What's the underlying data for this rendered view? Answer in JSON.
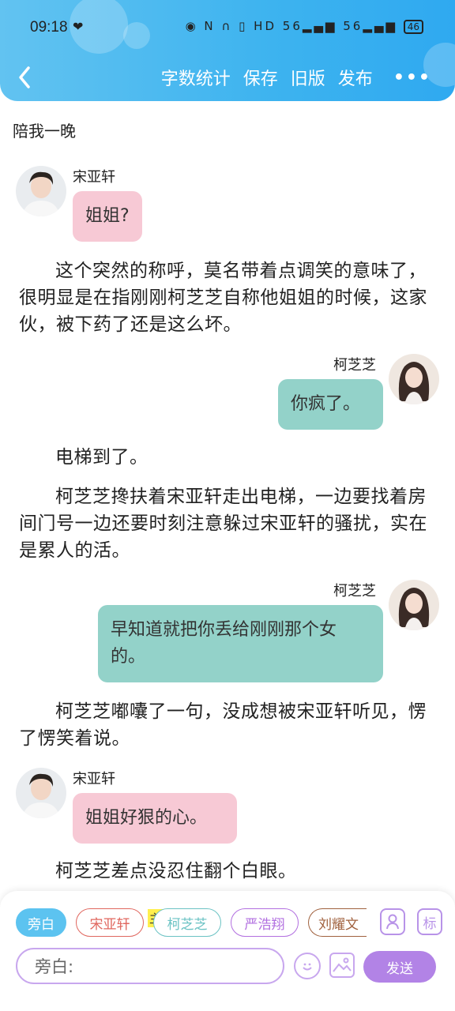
{
  "status_bar": {
    "time": "09:18",
    "icons_text": "◉ N ∩ ▯ HD 56▂▄▆ 56▂▄▆",
    "battery": "46"
  },
  "header": {
    "back_icon": "chevron-left-icon",
    "actions": [
      "字数统计",
      "保存",
      "旧版",
      "发布"
    ],
    "more_icon": "•••"
  },
  "chapter": {
    "title": "陪我一晚"
  },
  "messages": [
    {
      "speaker": "宋亚轩",
      "text": "姐姐?",
      "side": "left",
      "color": "#f7c9d5"
    },
    {
      "narration": "这个突然的称呼，莫名带着点调笑的意味了，很明显是在指刚刚柯芝芝自称他姐姐的时候，这家伙，被下药了还是这么坏。"
    },
    {
      "speaker": "柯芝芝",
      "text": "你疯了。",
      "side": "right",
      "color": "#93d2c9"
    },
    {
      "narration": "电梯到了。"
    },
    {
      "narration": "柯芝芝搀扶着宋亚轩走出电梯，一边要找着房间门号一边还要时刻注意躲过宋亚轩的骚扰，实在是累人的活。"
    },
    {
      "speaker": "柯芝芝",
      "text": "早知道就把你丢给刚刚那个女的。",
      "side": "right",
      "color": "#93d2c9"
    },
    {
      "narration": "柯芝芝嘟囔了一句，没成想被宋亚轩听见，愣了愣笑着说。"
    },
    {
      "speaker": "宋亚轩",
      "text": "姐姐好狠的心。",
      "side": "left",
      "color": "#f7c9d5"
    },
    {
      "narration": "柯芝芝差点没忍住翻个白眼。"
    }
  ],
  "bottom_bar": {
    "roles": [
      {
        "label": "旁白",
        "color": "#5cc3f0",
        "active": true
      },
      {
        "label": "宋亚轩",
        "color": "#e0675f",
        "active": false
      },
      {
        "label": "柯芝芝",
        "color": "#6cc3c4",
        "active": false
      },
      {
        "label": "严浩翔",
        "color": "#b26fe0",
        "active": false
      },
      {
        "label": "刘耀文",
        "color": "#a0613e",
        "active": false
      }
    ],
    "main_badge": "主",
    "tag_icon_label": "标",
    "input_placeholder": "旁白:",
    "send_label": "发送",
    "accent": "#b283e6"
  }
}
